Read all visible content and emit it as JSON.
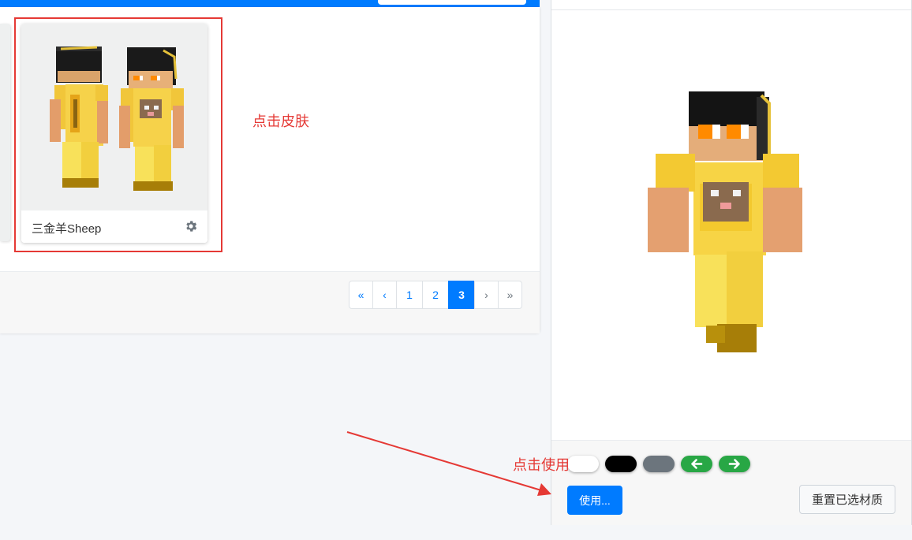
{
  "skin_list": {
    "skin_card": {
      "name": "三金羊Sheep"
    },
    "annotation_click_skin": "点击皮肤"
  },
  "pagination": {
    "first": "«",
    "prev": "‹",
    "pages": [
      "1",
      "2",
      "3"
    ],
    "active_page": "3",
    "next": "›",
    "last": "»"
  },
  "preview_panel": {
    "color_buttons": [
      {
        "name": "white",
        "color": "#ffffff"
      },
      {
        "name": "black",
        "color": "#000000"
      },
      {
        "name": "gray",
        "color": "#6c757d"
      },
      {
        "name": "rotate-left",
        "color": "#28a745",
        "icon": "arrow-left-icon"
      },
      {
        "name": "rotate-right",
        "color": "#28a745",
        "icon": "arrow-right-icon"
      }
    ],
    "use_button": "使用...",
    "reset_button": "重置已选材质",
    "annotation_click_use": "点击使用"
  },
  "colors": {
    "primary": "#007bff",
    "annotation_red": "#e53935",
    "gold": "#f5c431"
  }
}
